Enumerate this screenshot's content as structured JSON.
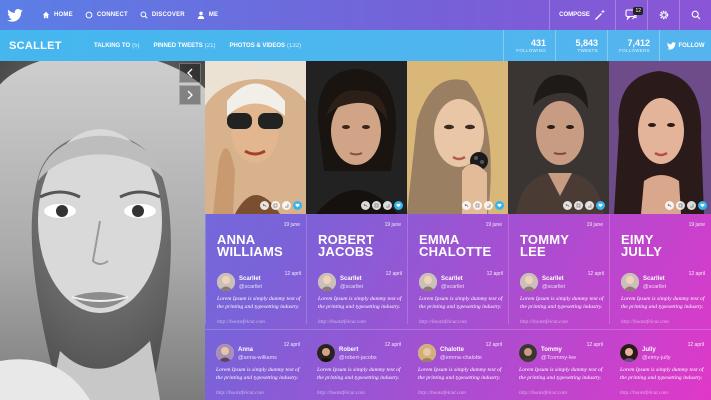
{
  "nav": {
    "home": "HOME",
    "connect": "CONNECT",
    "discover": "DISCOVER",
    "me": "ME",
    "compose": "COMPOSE",
    "messages_badge": "12"
  },
  "profile": {
    "brand": "SCALLET",
    "tabs": [
      {
        "label": "TALKING TO",
        "count": "(5)"
      },
      {
        "label": "PINNED TWEETS",
        "count": "(21)"
      },
      {
        "label": "PHOTOS & VIDEOS",
        "count": "(132)"
      }
    ],
    "stats": [
      {
        "value": "431",
        "label": "FOLLOWING"
      },
      {
        "value": "5,843",
        "label": "TWEETS"
      },
      {
        "value": "7,412",
        "label": "FOLLOWERS"
      }
    ],
    "follow": "FOLLOW"
  },
  "columns": [
    {
      "date": "19 june",
      "name_line1": "ANNA",
      "name_line2": "WILLIAMS",
      "t1_name": "Scarllet",
      "t1_handle": "@scarllet",
      "t1_date": "12 april",
      "t1_body": "Lorem Ipsum is simply dummy text of the printing and typesetting industry.",
      "t1_link": "http://bootstfelcut.com",
      "t2_name": "Anna",
      "t2_handle": "@anna-williams",
      "t2_date": "12 april",
      "t2_body": "Lorem Ipsum is simply dummy text of the printing and typesetting industry.",
      "t2_link": "http://bootstfelcut.com"
    },
    {
      "date": "19 june",
      "name_line1": "ROBERT",
      "name_line2": "JACOBS",
      "t1_name": "Scarllet",
      "t1_handle": "@scarllet",
      "t1_date": "12 april",
      "t1_body": "Lorem Ipsum is simply dummy text of the printing and typesetting industry.",
      "t1_link": "http://bootstfelcut.com",
      "t2_name": "Robert",
      "t2_handle": "@robert-jacobs",
      "t2_date": "12 april",
      "t2_body": "Lorem Ipsum is simply dummy text of the printing and typesetting industry.",
      "t2_link": "http://bootstfelcut.com"
    },
    {
      "date": "19 june",
      "name_line1": "EMMA",
      "name_line2": "CHALOTTE",
      "t1_name": "Scarllet",
      "t1_handle": "@scarllet",
      "t1_date": "12 april",
      "t1_body": "Lorem Ipsum is simply dummy text of the printing and typesetting industry.",
      "t1_link": "http://bootstfelcut.com",
      "t2_name": "Chalotte",
      "t2_handle": "@emma-chalotte",
      "t2_date": "12 april",
      "t2_body": "Lorem Ipsum is simply dummy text of the printing and typesetting industry.",
      "t2_link": "http://bootstfelcut.com"
    },
    {
      "date": "19 june",
      "name_line1": "TOMMY",
      "name_line2": "LEE",
      "t1_name": "Scarllet",
      "t1_handle": "@scarllet",
      "t1_date": "12 april",
      "t1_body": "Lorem Ipsum is simply dummy text of the printing and typesetting industry.",
      "t1_link": "http://bootstfelcut.com",
      "t2_name": "Tommy",
      "t2_handle": "@Tcommy-lee",
      "t2_date": "12 april",
      "t2_body": "Lorem Ipsum is simply dummy text of the printing and typesetting industry.",
      "t2_link": "http://bootstfelcut.com"
    },
    {
      "date": "19 june",
      "name_line1": "EIMY",
      "name_line2": "JULLY",
      "t1_name": "Scarllet",
      "t1_handle": "@scarllet",
      "t1_date": "12 april",
      "t1_body": "Lorem Ipsum is simply dummy text of the printing and typesetting industry.",
      "t1_link": "http://bootstfelcut.com",
      "t2_name": "Jully",
      "t2_handle": "@eimy-jully",
      "t2_date": "12 april",
      "t2_body": "Lorem Ipsum is simply dummy text of the printing and typesetting industry.",
      "t2_link": "http://bootstfelcut.com"
    }
  ],
  "colors": {
    "nav_bg": "#6a6fdc",
    "profile_bar": "#4ab6ee",
    "accent_like": "#35b4ee",
    "gradient_end": "#e038c8"
  }
}
